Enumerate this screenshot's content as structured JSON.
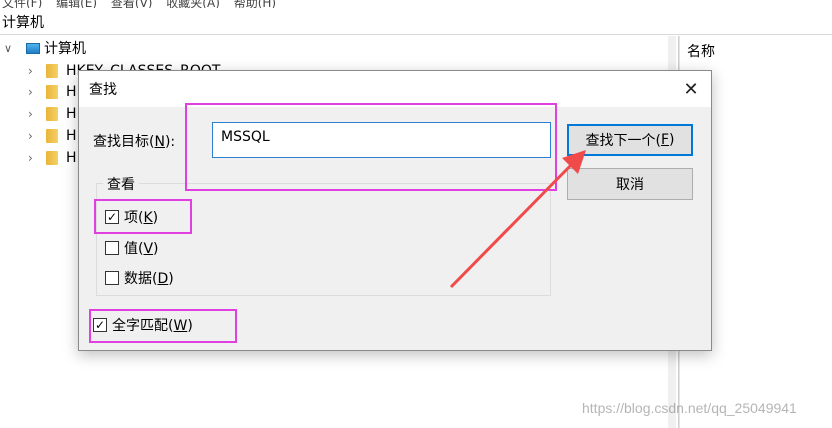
{
  "menubar": {
    "items": [
      "文件(F)",
      "编辑(E)",
      "查看(V)",
      "收藏夹(A)",
      "帮助(H)"
    ]
  },
  "address": {
    "text": "计算机"
  },
  "tree": {
    "root_label": "计算机",
    "items": [
      "HKEY_CLASSES_ROOT",
      "H",
      "H",
      "H",
      "H"
    ]
  },
  "right_pane": {
    "column_name": "名称"
  },
  "dialog": {
    "title": "查找",
    "target_label_prefix": "查找目标(",
    "target_label_key": "N",
    "target_label_suffix": "):",
    "target_value": "MSSQL",
    "find_next_prefix": "查找下一个(",
    "find_next_key": "F",
    "find_next_suffix": ")",
    "cancel_label": "取消",
    "group_label": "查看",
    "options": [
      {
        "prefix": "项(",
        "key": "K",
        "suffix": ")",
        "checked": true
      },
      {
        "prefix": "值(",
        "key": "V",
        "suffix": ")",
        "checked": false
      },
      {
        "prefix": "数据(",
        "key": "D",
        "suffix": ")",
        "checked": false
      }
    ],
    "whole_word": {
      "prefix": "全字匹配(",
      "key": "W",
      "suffix": ")",
      "checked": true
    }
  },
  "annotation_color": "#e040e0",
  "arrow_color": "#f04a4a",
  "watermark": "https://blog.csdn.net/qq_25049941"
}
